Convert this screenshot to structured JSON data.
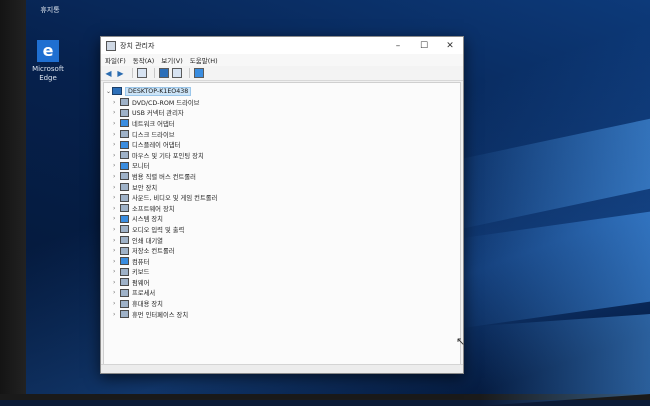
{
  "desktop": {
    "icons": [
      {
        "label": "휴지통"
      },
      {
        "label": "Microsoft Edge",
        "glyph": "e"
      }
    ]
  },
  "window": {
    "title": "장치 관리자",
    "controls": {
      "minimize": "–",
      "maximize": "☐",
      "close": "✕"
    },
    "menu": [
      "파일(F)",
      "동작(A)",
      "보기(V)",
      "도움말(H)"
    ],
    "toolbar": {
      "back": "◀",
      "forward": "▶"
    },
    "tree": {
      "root": "DESKTOP-K1EO438",
      "items": [
        "DVD/CD-ROM 드라이브",
        "USB 커넥터 관리자",
        "네트워크 어댑터",
        "디스크 드라이브",
        "디스플레이 어댑터",
        "마우스 및 기타 포인팅 장치",
        "모니터",
        "범용 직렬 버스 컨트롤러",
        "보안 장치",
        "사운드, 비디오 및 게임 컨트롤러",
        "소프트웨어 장치",
        "시스템 장치",
        "오디오 입력 및 출력",
        "인쇄 대기열",
        "저장소 컨트롤러",
        "컴퓨터",
        "키보드",
        "펌웨어",
        "프로세서",
        "휴대용 장치",
        "휴먼 인터페이스 장치"
      ]
    }
  },
  "colors": {
    "desktop": "#0d3a7a",
    "accent": "#1f6fd1",
    "selection": "#cce4f7"
  }
}
